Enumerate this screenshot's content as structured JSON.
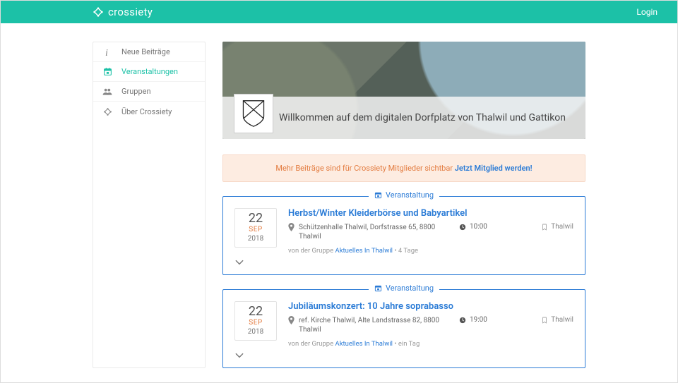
{
  "header": {
    "brand": "crossiety",
    "login": "Login"
  },
  "sidebar": {
    "items": [
      {
        "icon": "info-italic-icon",
        "label": "Neue Beiträge"
      },
      {
        "icon": "calendar-icon",
        "label": "Veranstaltungen"
      },
      {
        "icon": "people-icon",
        "label": "Gruppen"
      },
      {
        "icon": "cross-logo-icon",
        "label": "Über Crossiety"
      }
    ]
  },
  "hero": {
    "title": "Willkommen auf dem digitalen Dorfplatz von Thalwil und Gattikon"
  },
  "notice": {
    "text": "Mehr Beiträge sind für Crossiety Mitglieder sichtbar ",
    "cta": "Jetzt Mitglied werden!"
  },
  "events_label": "Veranstaltung",
  "events": [
    {
      "day": "22",
      "mon": "SEP",
      "year": "2018",
      "title": "Herbst/Winter Kleiderbörse und Babyartikel",
      "location": "Schützenhalle Thalwil, Dorfstrasse 65, 8800 Thalwil",
      "time": "10:00",
      "tag": "Thalwil",
      "meta_prefix": "von der Gruppe ",
      "meta_link": "Aktuelles In Thalwil",
      "meta_suffix": " • 4 Tage"
    },
    {
      "day": "22",
      "mon": "SEP",
      "year": "2018",
      "title": "Jubiläumskonzert: 10 Jahre soprabasso",
      "location": "ref. Kirche Thalwil, Alte Landstrasse 82, 8800 Thalwil",
      "time": "19:00",
      "tag": "Thalwil",
      "meta_prefix": "von der Gruppe ",
      "meta_link": "Aktuelles In Thalwil",
      "meta_suffix": " • ein Tag"
    }
  ]
}
